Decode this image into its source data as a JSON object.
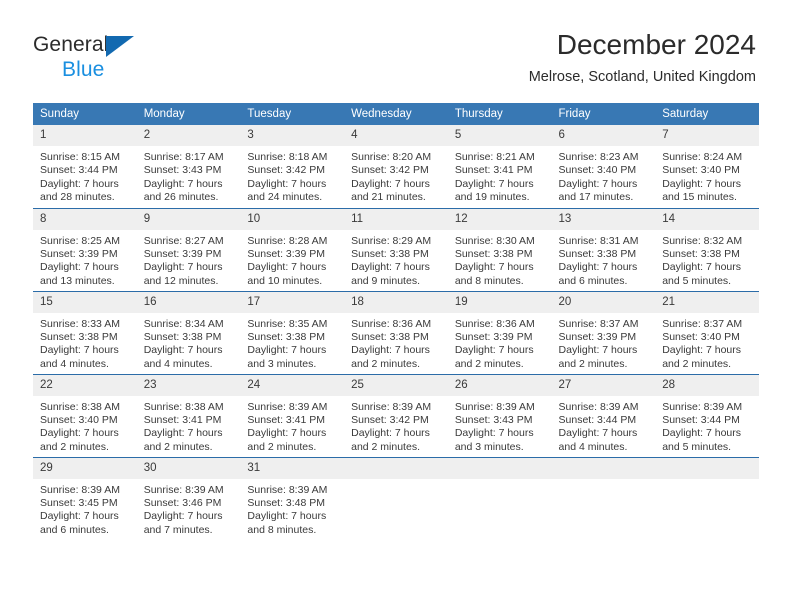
{
  "brand": {
    "name_part1": "General",
    "name_part2": "Blue",
    "flag_icon": "triangle-flag-icon"
  },
  "header": {
    "title": "December 2024",
    "location": "Melrose, Scotland, United Kingdom"
  },
  "colors": {
    "header_blue": "#3878b4",
    "row_divider_blue": "#2b6ca8",
    "daynum_band": "#efefef",
    "brand_dark": "#2b2b2b",
    "brand_blue": "#1a8fe0",
    "flag_blue": "#1269b0"
  },
  "weekdays": [
    "Sunday",
    "Monday",
    "Tuesday",
    "Wednesday",
    "Thursday",
    "Friday",
    "Saturday"
  ],
  "weeks": [
    [
      {
        "day": "1",
        "sunrise": "Sunrise: 8:15 AM",
        "sunset": "Sunset: 3:44 PM",
        "daylight_line1": "Daylight: 7 hours",
        "daylight_line2": "and 28 minutes."
      },
      {
        "day": "2",
        "sunrise": "Sunrise: 8:17 AM",
        "sunset": "Sunset: 3:43 PM",
        "daylight_line1": "Daylight: 7 hours",
        "daylight_line2": "and 26 minutes."
      },
      {
        "day": "3",
        "sunrise": "Sunrise: 8:18 AM",
        "sunset": "Sunset: 3:42 PM",
        "daylight_line1": "Daylight: 7 hours",
        "daylight_line2": "and 24 minutes."
      },
      {
        "day": "4",
        "sunrise": "Sunrise: 8:20 AM",
        "sunset": "Sunset: 3:42 PM",
        "daylight_line1": "Daylight: 7 hours",
        "daylight_line2": "and 21 minutes."
      },
      {
        "day": "5",
        "sunrise": "Sunrise: 8:21 AM",
        "sunset": "Sunset: 3:41 PM",
        "daylight_line1": "Daylight: 7 hours",
        "daylight_line2": "and 19 minutes."
      },
      {
        "day": "6",
        "sunrise": "Sunrise: 8:23 AM",
        "sunset": "Sunset: 3:40 PM",
        "daylight_line1": "Daylight: 7 hours",
        "daylight_line2": "and 17 minutes."
      },
      {
        "day": "7",
        "sunrise": "Sunrise: 8:24 AM",
        "sunset": "Sunset: 3:40 PM",
        "daylight_line1": "Daylight: 7 hours",
        "daylight_line2": "and 15 minutes."
      }
    ],
    [
      {
        "day": "8",
        "sunrise": "Sunrise: 8:25 AM",
        "sunset": "Sunset: 3:39 PM",
        "daylight_line1": "Daylight: 7 hours",
        "daylight_line2": "and 13 minutes."
      },
      {
        "day": "9",
        "sunrise": "Sunrise: 8:27 AM",
        "sunset": "Sunset: 3:39 PM",
        "daylight_line1": "Daylight: 7 hours",
        "daylight_line2": "and 12 minutes."
      },
      {
        "day": "10",
        "sunrise": "Sunrise: 8:28 AM",
        "sunset": "Sunset: 3:39 PM",
        "daylight_line1": "Daylight: 7 hours",
        "daylight_line2": "and 10 minutes."
      },
      {
        "day": "11",
        "sunrise": "Sunrise: 8:29 AM",
        "sunset": "Sunset: 3:38 PM",
        "daylight_line1": "Daylight: 7 hours",
        "daylight_line2": "and 9 minutes."
      },
      {
        "day": "12",
        "sunrise": "Sunrise: 8:30 AM",
        "sunset": "Sunset: 3:38 PM",
        "daylight_line1": "Daylight: 7 hours",
        "daylight_line2": "and 8 minutes."
      },
      {
        "day": "13",
        "sunrise": "Sunrise: 8:31 AM",
        "sunset": "Sunset: 3:38 PM",
        "daylight_line1": "Daylight: 7 hours",
        "daylight_line2": "and 6 minutes."
      },
      {
        "day": "14",
        "sunrise": "Sunrise: 8:32 AM",
        "sunset": "Sunset: 3:38 PM",
        "daylight_line1": "Daylight: 7 hours",
        "daylight_line2": "and 5 minutes."
      }
    ],
    [
      {
        "day": "15",
        "sunrise": "Sunrise: 8:33 AM",
        "sunset": "Sunset: 3:38 PM",
        "daylight_line1": "Daylight: 7 hours",
        "daylight_line2": "and 4 minutes."
      },
      {
        "day": "16",
        "sunrise": "Sunrise: 8:34 AM",
        "sunset": "Sunset: 3:38 PM",
        "daylight_line1": "Daylight: 7 hours",
        "daylight_line2": "and 4 minutes."
      },
      {
        "day": "17",
        "sunrise": "Sunrise: 8:35 AM",
        "sunset": "Sunset: 3:38 PM",
        "daylight_line1": "Daylight: 7 hours",
        "daylight_line2": "and 3 minutes."
      },
      {
        "day": "18",
        "sunrise": "Sunrise: 8:36 AM",
        "sunset": "Sunset: 3:38 PM",
        "daylight_line1": "Daylight: 7 hours",
        "daylight_line2": "and 2 minutes."
      },
      {
        "day": "19",
        "sunrise": "Sunrise: 8:36 AM",
        "sunset": "Sunset: 3:39 PM",
        "daylight_line1": "Daylight: 7 hours",
        "daylight_line2": "and 2 minutes."
      },
      {
        "day": "20",
        "sunrise": "Sunrise: 8:37 AM",
        "sunset": "Sunset: 3:39 PM",
        "daylight_line1": "Daylight: 7 hours",
        "daylight_line2": "and 2 minutes."
      },
      {
        "day": "21",
        "sunrise": "Sunrise: 8:37 AM",
        "sunset": "Sunset: 3:40 PM",
        "daylight_line1": "Daylight: 7 hours",
        "daylight_line2": "and 2 minutes."
      }
    ],
    [
      {
        "day": "22",
        "sunrise": "Sunrise: 8:38 AM",
        "sunset": "Sunset: 3:40 PM",
        "daylight_line1": "Daylight: 7 hours",
        "daylight_line2": "and 2 minutes."
      },
      {
        "day": "23",
        "sunrise": "Sunrise: 8:38 AM",
        "sunset": "Sunset: 3:41 PM",
        "daylight_line1": "Daylight: 7 hours",
        "daylight_line2": "and 2 minutes."
      },
      {
        "day": "24",
        "sunrise": "Sunrise: 8:39 AM",
        "sunset": "Sunset: 3:41 PM",
        "daylight_line1": "Daylight: 7 hours",
        "daylight_line2": "and 2 minutes."
      },
      {
        "day": "25",
        "sunrise": "Sunrise: 8:39 AM",
        "sunset": "Sunset: 3:42 PM",
        "daylight_line1": "Daylight: 7 hours",
        "daylight_line2": "and 2 minutes."
      },
      {
        "day": "26",
        "sunrise": "Sunrise: 8:39 AM",
        "sunset": "Sunset: 3:43 PM",
        "daylight_line1": "Daylight: 7 hours",
        "daylight_line2": "and 3 minutes."
      },
      {
        "day": "27",
        "sunrise": "Sunrise: 8:39 AM",
        "sunset": "Sunset: 3:44 PM",
        "daylight_line1": "Daylight: 7 hours",
        "daylight_line2": "and 4 minutes."
      },
      {
        "day": "28",
        "sunrise": "Sunrise: 8:39 AM",
        "sunset": "Sunset: 3:44 PM",
        "daylight_line1": "Daylight: 7 hours",
        "daylight_line2": "and 5 minutes."
      }
    ],
    [
      {
        "day": "29",
        "sunrise": "Sunrise: 8:39 AM",
        "sunset": "Sunset: 3:45 PM",
        "daylight_line1": "Daylight: 7 hours",
        "daylight_line2": "and 6 minutes."
      },
      {
        "day": "30",
        "sunrise": "Sunrise: 8:39 AM",
        "sunset": "Sunset: 3:46 PM",
        "daylight_line1": "Daylight: 7 hours",
        "daylight_line2": "and 7 minutes."
      },
      {
        "day": "31",
        "sunrise": "Sunrise: 8:39 AM",
        "sunset": "Sunset: 3:48 PM",
        "daylight_line1": "Daylight: 7 hours",
        "daylight_line2": "and 8 minutes."
      },
      {
        "day": "",
        "sunrise": "",
        "sunset": "",
        "daylight_line1": "",
        "daylight_line2": ""
      },
      {
        "day": "",
        "sunrise": "",
        "sunset": "",
        "daylight_line1": "",
        "daylight_line2": ""
      },
      {
        "day": "",
        "sunrise": "",
        "sunset": "",
        "daylight_line1": "",
        "daylight_line2": ""
      },
      {
        "day": "",
        "sunrise": "",
        "sunset": "",
        "daylight_line1": "",
        "daylight_line2": ""
      }
    ]
  ]
}
